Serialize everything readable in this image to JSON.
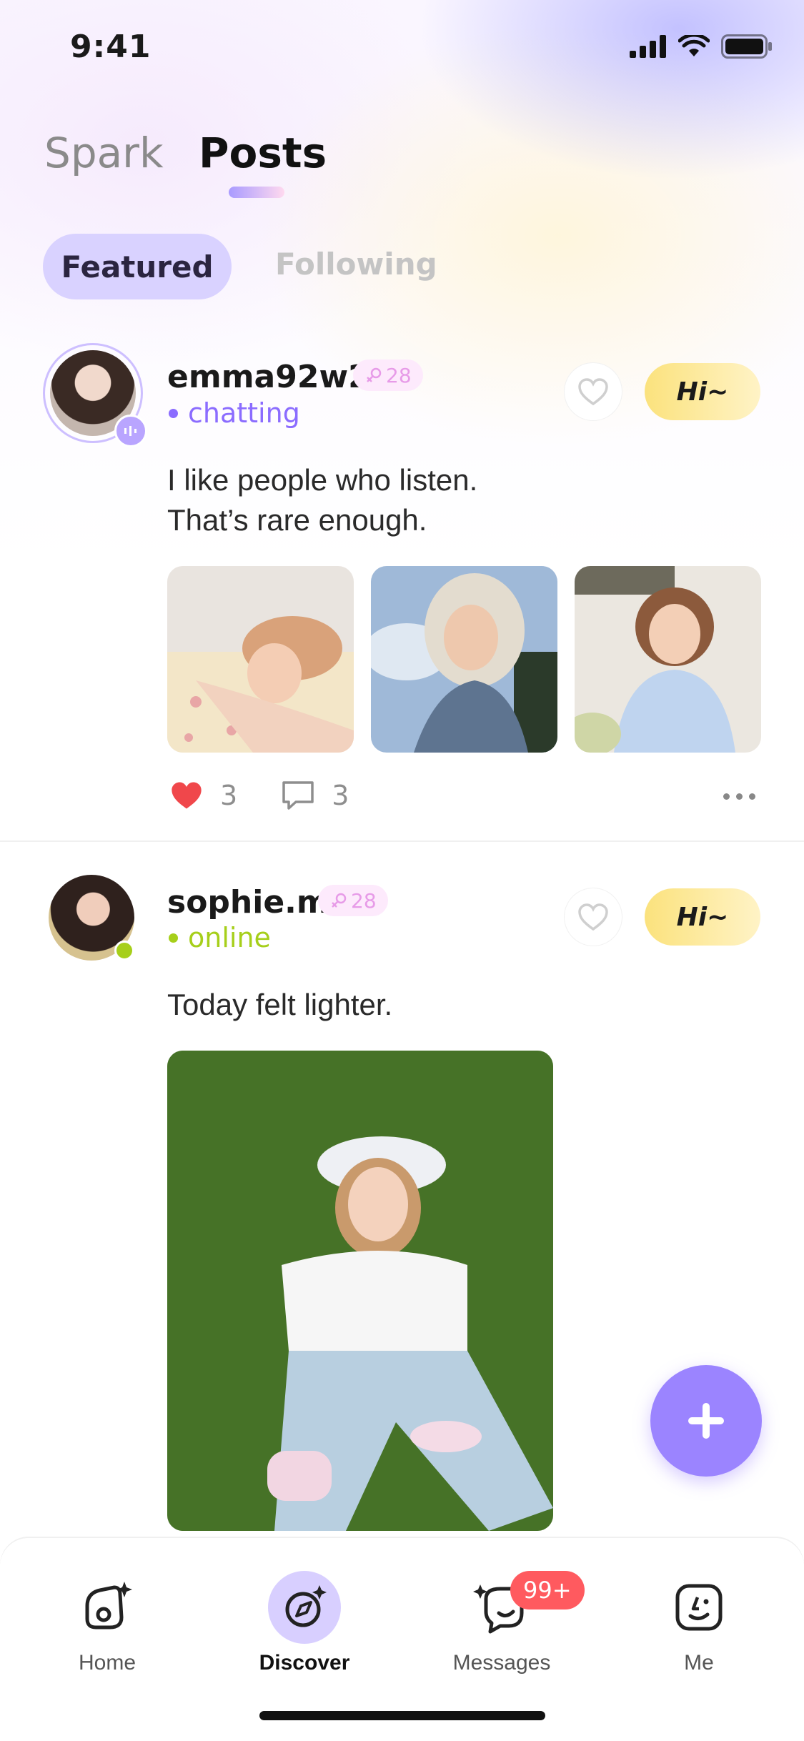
{
  "status_bar": {
    "time": "9:41"
  },
  "top_tabs": {
    "spark": "Spark",
    "posts": "Posts"
  },
  "sub_tabs": {
    "featured": "Featured",
    "following": "Following"
  },
  "posts": [
    {
      "username": "emma92w2",
      "level": "28",
      "status": "chatting",
      "status_color": "#8b6cff",
      "text_lines": [
        "I like people who listen.",
        "That’s rare enough."
      ],
      "hi_label": "Hi~",
      "likes": "3",
      "comments": "3"
    },
    {
      "username": "sophie.m",
      "level": "28",
      "status": "online",
      "status_color": "#a6cf1a",
      "text_lines": [
        "Today felt lighter."
      ],
      "hi_label": "Hi~"
    }
  ],
  "tab_bar": {
    "home": "Home",
    "discover": "Discover",
    "messages": "Messages",
    "messages_badge": "99+",
    "me": "Me"
  },
  "colors": {
    "accent": "#9b84ff",
    "hi_button": "#fbe27d",
    "badge": "#ff5a5f"
  }
}
